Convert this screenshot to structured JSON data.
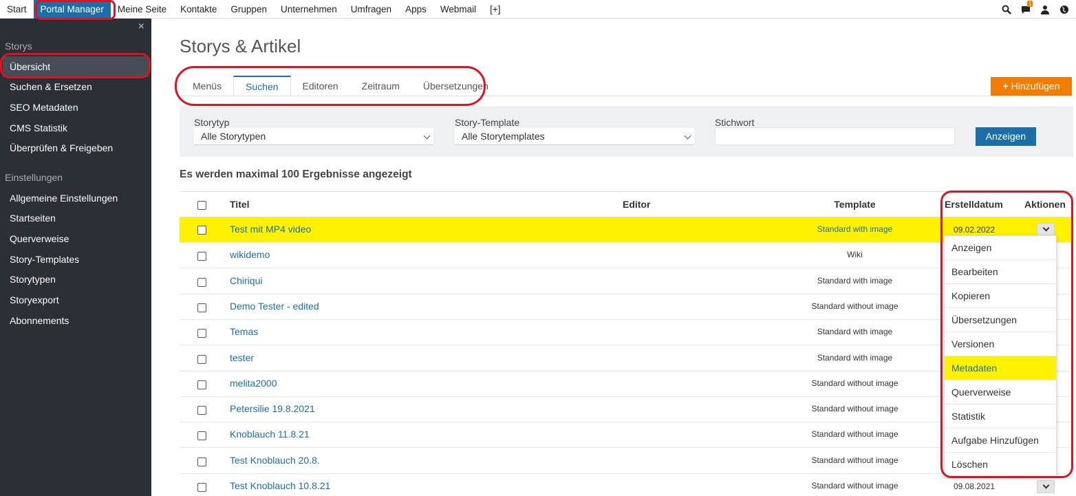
{
  "topnav": {
    "items": [
      "Start",
      "Portal Manager",
      "Meine Seite",
      "Kontakte",
      "Gruppen",
      "Unternehmen",
      "Umfragen",
      "Apps",
      "Webmail",
      "[+]"
    ],
    "active_index": 1,
    "icons": [
      "search-icon",
      "chat-icon",
      "user-icon",
      "globe-icon"
    ],
    "chat_badge": "1"
  },
  "sidebar": {
    "close": "×",
    "section1": "Storys",
    "items1": [
      "Übersicht",
      "Suchen & Ersetzen",
      "SEO Metadaten",
      "CMS Statistik",
      "Überprüfen & Freigeben"
    ],
    "section2": "Einstellungen",
    "items2": [
      "Allgemeine Einstellungen",
      "Startseiten",
      "Querverweise",
      "Story-Templates",
      "Storytypen",
      "Storyexport",
      "Abonnements"
    ]
  },
  "main": {
    "title": "Storys & Artikel",
    "tabs": [
      "Menüs",
      "Suchen",
      "Editoren",
      "Zeitraum",
      "Übersetzungen"
    ],
    "active_tab": 1,
    "add_label": "Hinzufügen",
    "filter": {
      "storytyp_label": "Storytyp",
      "storytyp_value": "Alle Storytypen",
      "template_label": "Story-Template",
      "template_value": "Alle Storytemplates",
      "stichwort_label": "Stichwort",
      "stichwort_value": "",
      "show_label": "Anzeigen"
    },
    "results_info": "Es werden maximal 100 Ergebnisse angezeigt"
  },
  "table": {
    "headers": {
      "title": "Titel",
      "editor": "Editor",
      "template": "Template",
      "date": "Erstelldatum",
      "actions": "Aktionen"
    },
    "rows": [
      {
        "title": "Test mit MP4 video",
        "template": "Standard with image",
        "date": "09.02.2022"
      },
      {
        "title": "wikidemo",
        "template": "Wiki",
        "date": ""
      },
      {
        "title": "Chiriqui",
        "template": "Standard with image",
        "date": ""
      },
      {
        "title": "Demo Tester - edited",
        "template": "Standard without image",
        "date": ""
      },
      {
        "title": "Temas",
        "template": "Standard with image",
        "date": ""
      },
      {
        "title": "tester",
        "template": "Standard with image",
        "date": ""
      },
      {
        "title": "melita2000",
        "template": "Standard without image",
        "date": ""
      },
      {
        "title": "Petersilie 19.8.2021",
        "template": "Standard without image",
        "date": ""
      },
      {
        "title": "Knoblauch 11.8.21",
        "template": "Standard without image",
        "date": ""
      },
      {
        "title": "Test Knoblauch 20.8.",
        "template": "Standard without image",
        "date": ""
      },
      {
        "title": "Test Knoblauch 10.8.21",
        "template": "Standard without image",
        "date": "09.08.2021"
      }
    ]
  },
  "action_menu": {
    "items": [
      "Anzeigen",
      "Bearbeiten",
      "Kopieren",
      "Übersetzungen",
      "Versionen",
      "Metadaten",
      "Querverweise",
      "Statistik",
      "Aufgabe Hinzufügen",
      "Löschen"
    ],
    "highlighted_index": 5
  },
  "colors": {
    "brand": "#1a6fa8",
    "accent": "#f07c00",
    "highlight": "#fff200",
    "annotation": "#e0121f",
    "sidebar": "#2b2f36"
  }
}
